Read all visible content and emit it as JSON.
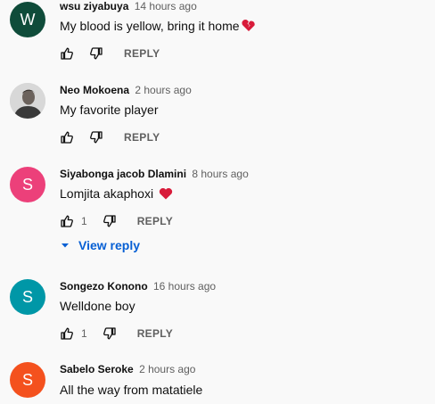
{
  "comments": [
    {
      "avatar_letter": "W",
      "avatar_color": "#0f4c3a",
      "author": "wsu ziyabuya",
      "time": "14 hours ago",
      "text": "My blood is yellow, bring it home",
      "emoji": "broken-heart",
      "likes": "",
      "reply_label": "REPLY"
    },
    {
      "avatar_letter": "",
      "avatar_color": "#c9c9c9",
      "author": "Neo Mokoena",
      "time": "2 hours ago",
      "text": "My favorite player",
      "likes": "",
      "reply_label": "REPLY"
    },
    {
      "avatar_letter": "S",
      "avatar_color": "#ec407a",
      "author": "Siyabonga jacob Dlamini",
      "time": "8 hours ago",
      "text": "Lomjita akaphoxi",
      "emoji": "red-heart",
      "likes": "1",
      "reply_label": "REPLY",
      "view_reply_label": "View reply"
    },
    {
      "avatar_letter": "S",
      "avatar_color": "#0097a7",
      "author": "Songezo Konono",
      "time": "16 hours ago",
      "text": "Welldone boy",
      "likes": "1",
      "reply_label": "REPLY"
    },
    {
      "avatar_letter": "S",
      "avatar_color": "#f4511e",
      "author": "Sabelo Seroke",
      "time": "2 hours ago",
      "text": "All the way from matatiele",
      "likes": "",
      "reply_label": ""
    }
  ]
}
